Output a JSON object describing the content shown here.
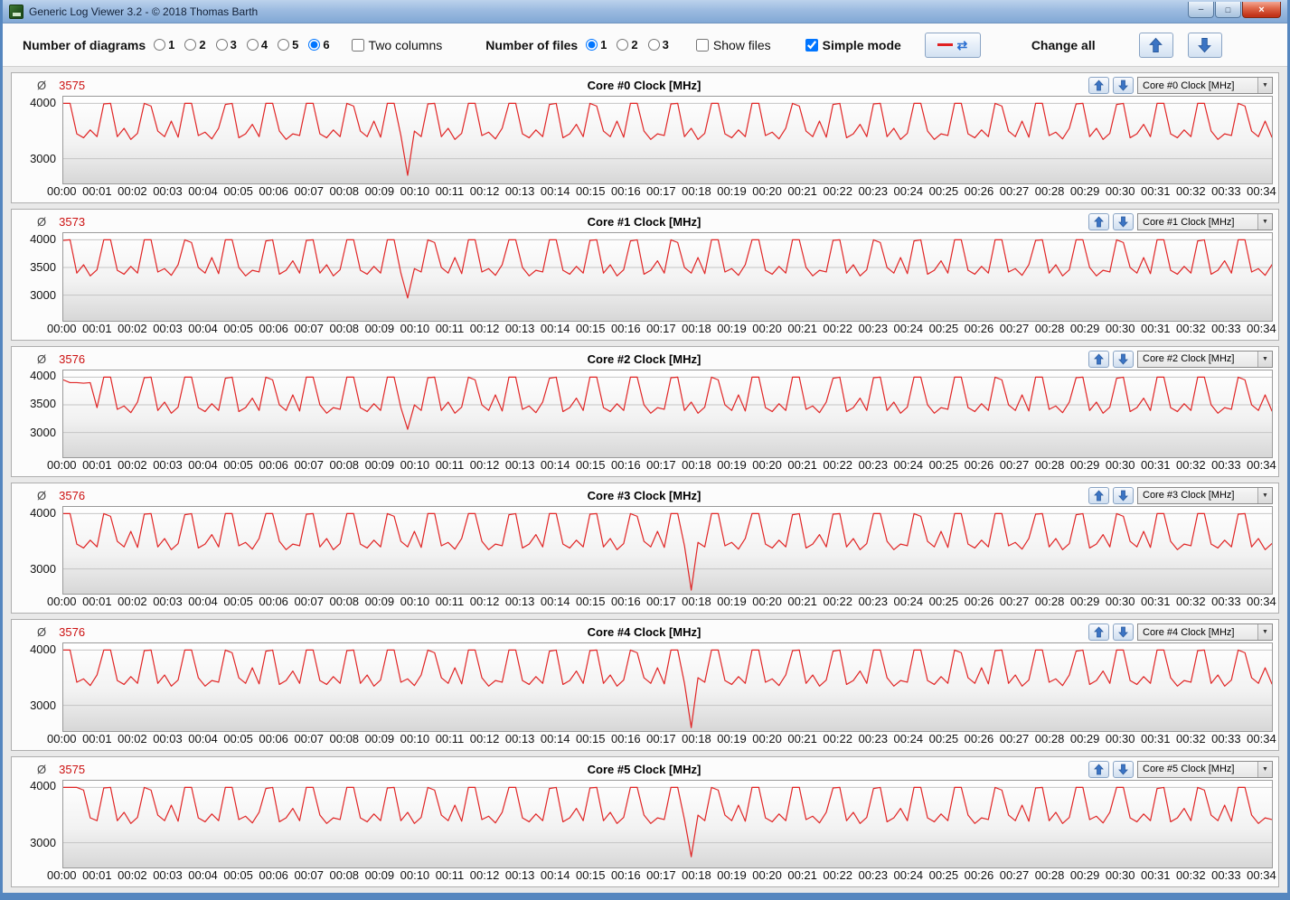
{
  "window": {
    "title": "Generic Log Viewer 3.2 - © 2018 Thomas Barth",
    "minimize_glyph": "–",
    "maximize_glyph": "□",
    "close_glyph": "×"
  },
  "toolbar": {
    "diagrams_label": "Number of diagrams",
    "diagram_options": [
      "1",
      "2",
      "3",
      "4",
      "5",
      "6"
    ],
    "diagrams_selected": "6",
    "two_columns_label": "Two columns",
    "two_columns_checked": false,
    "files_label": "Number of files",
    "file_options": [
      "1",
      "2",
      "3"
    ],
    "files_selected": "1",
    "show_files_label": "Show files",
    "show_files_checked": false,
    "simple_mode_label": "Simple mode",
    "simple_mode_checked": true,
    "refresh_glyph": "⇄",
    "change_all_label": "Change all"
  },
  "colors": {
    "trace": "#e02525",
    "average_text": "#cc1111",
    "grid": "#c4c4c4"
  },
  "avg_symbol": "Ø",
  "x_labels": [
    "00:00",
    "00:01",
    "00:02",
    "00:03",
    "00:04",
    "00:05",
    "00:06",
    "00:07",
    "00:08",
    "00:09",
    "00:10",
    "00:11",
    "00:12",
    "00:13",
    "00:14",
    "00:15",
    "00:16",
    "00:17",
    "00:18",
    "00:19",
    "00:20",
    "00:21",
    "00:22",
    "00:23",
    "00:24",
    "00:25",
    "00:26",
    "00:27",
    "00:28",
    "00:29",
    "00:30",
    "00:31",
    "00:32",
    "00:33",
    "00:34"
  ],
  "chart_data": [
    {
      "type": "line",
      "title": "Core #0 Clock [MHz]",
      "avg": "3575",
      "y_ticks": [
        4000,
        3000
      ],
      "ylim": [
        2550,
        4120
      ],
      "x_range_minutes": [
        0,
        34
      ],
      "values": [
        4000,
        4000,
        3450,
        3380,
        3520,
        3400,
        3990,
        4000,
        3400,
        3550,
        3350,
        3460,
        4000,
        3950,
        3500,
        3400,
        3680,
        3390,
        4000,
        4000,
        3420,
        3480,
        3360,
        3550,
        3980,
        4000,
        3380,
        3450,
        3620,
        3400,
        4000,
        4000,
        3500,
        3350,
        3450,
        3420,
        4000,
        4000,
        3450,
        3380,
        3520,
        3400,
        4000,
        3950,
        3500,
        3400,
        3680,
        3390,
        4000,
        4000,
        3420,
        2700,
        3500,
        3400,
        3990,
        4000,
        3400,
        3550,
        3350,
        3460,
        4000,
        4000,
        3420,
        3480,
        3360,
        3550,
        4000,
        4000,
        3450,
        3380,
        3520,
        3400,
        3980,
        4000,
        3380,
        3450,
        3620,
        3400,
        4000,
        3950,
        3500,
        3400,
        3680,
        3390,
        4000,
        4000,
        3500,
        3350,
        3450,
        3420,
        3990,
        4000,
        3400,
        3550,
        3350,
        3460,
        4000,
        4000,
        3450,
        3380,
        3520,
        3400,
        4000,
        4000,
        3420,
        3480,
        3360,
        3550,
        4000,
        3950,
        3500,
        3400,
        3680,
        3390,
        3980,
        4000,
        3380,
        3450,
        3620,
        3400,
        3990,
        4000,
        3400,
        3550,
        3350,
        3460,
        4000,
        4000,
        3500,
        3350,
        3450,
        3420,
        4000,
        4000,
        3450,
        3380,
        3520,
        3400,
        4000,
        3950,
        3500,
        3400,
        3680,
        3390,
        4000,
        4000,
        3420,
        3480,
        3360,
        3550,
        3990,
        4000,
        3400,
        3550,
        3350,
        3460,
        3980,
        4000,
        3380,
        3450,
        3620,
        3400,
        4000,
        4000,
        3450,
        3380,
        3520,
        3400,
        4000,
        4000,
        3500,
        3350,
        3450,
        3420,
        4000,
        3950,
        3500,
        3400,
        3680,
        3390
      ]
    },
    {
      "type": "line",
      "title": "Core #1 Clock [MHz]",
      "avg": "3573",
      "y_ticks": [
        4000,
        3500,
        3000
      ],
      "ylim": [
        2550,
        4120
      ],
      "x_range_minutes": [
        0,
        34
      ],
      "values": [
        3990,
        4000,
        3400,
        3550,
        3350,
        3460,
        4000,
        4000,
        3450,
        3380,
        3520,
        3400,
        4000,
        4000,
        3420,
        3480,
        3360,
        3550,
        4000,
        3950,
        3500,
        3400,
        3680,
        3390,
        4000,
        4000,
        3500,
        3350,
        3450,
        3420,
        3980,
        4000,
        3380,
        3450,
        3620,
        3400,
        3990,
        4000,
        3400,
        3550,
        3350,
        3460,
        4000,
        4000,
        3450,
        3380,
        3520,
        3400,
        4000,
        4000,
        3400,
        2950,
        3480,
        3420,
        4000,
        3950,
        3500,
        3400,
        3680,
        3390,
        4000,
        4000,
        3420,
        3480,
        3360,
        3550,
        4000,
        4000,
        3500,
        3350,
        3450,
        3420,
        4000,
        4000,
        3450,
        3380,
        3520,
        3400,
        3990,
        4000,
        3400,
        3550,
        3350,
        3460,
        3980,
        4000,
        3380,
        3450,
        3620,
        3400,
        4000,
        3950,
        3500,
        3400,
        3680,
        3390,
        4000,
        4000,
        3420,
        3480,
        3360,
        3550,
        4000,
        4000,
        3450,
        3380,
        3520,
        3400,
        4000,
        4000,
        3500,
        3350,
        3450,
        3420,
        3990,
        4000,
        3400,
        3550,
        3350,
        3460,
        4000,
        3950,
        3500,
        3400,
        3680,
        3390,
        3980,
        4000,
        3380,
        3450,
        3620,
        3400,
        4000,
        4000,
        3450,
        3380,
        3520,
        3400,
        4000,
        4000,
        3420,
        3480,
        3360,
        3550,
        3990,
        4000,
        3400,
        3550,
        3350,
        3460,
        4000,
        4000,
        3500,
        3350,
        3450,
        3420,
        4000,
        3950,
        3500,
        3400,
        3680,
        3390,
        4000,
        4000,
        3450,
        3380,
        3520,
        3400,
        3980,
        4000,
        3380,
        3450,
        3620,
        3400,
        4000,
        4000,
        3420,
        3480,
        3360,
        3550
      ]
    },
    {
      "type": "line",
      "title": "Core #2 Clock [MHz]",
      "avg": "3576",
      "y_ticks": [
        4000,
        3500,
        3000
      ],
      "ylim": [
        2550,
        4120
      ],
      "x_range_minutes": [
        0,
        34
      ],
      "values": [
        3950,
        3900,
        3900,
        3890,
        3900,
        3450,
        4000,
        4000,
        3420,
        3480,
        3360,
        3550,
        3990,
        4000,
        3400,
        3550,
        3350,
        3460,
        4000,
        4000,
        3450,
        3380,
        3520,
        3400,
        3980,
        4000,
        3380,
        3450,
        3620,
        3400,
        4000,
        3950,
        3500,
        3400,
        3680,
        3390,
        4000,
        4000,
        3500,
        3350,
        3450,
        3420,
        4000,
        4000,
        3450,
        3380,
        3520,
        3400,
        4000,
        4000,
        3450,
        3060,
        3500,
        3400,
        3990,
        4000,
        3400,
        3550,
        3350,
        3460,
        4000,
        3950,
        3500,
        3400,
        3680,
        3390,
        4000,
        4000,
        3420,
        3480,
        3360,
        3550,
        3980,
        4000,
        3380,
        3450,
        3620,
        3400,
        4000,
        4000,
        3450,
        3380,
        3520,
        3400,
        4000,
        4000,
        3500,
        3350,
        3450,
        3420,
        3990,
        4000,
        3400,
        3550,
        3350,
        3460,
        4000,
        3950,
        3500,
        3400,
        3680,
        3390,
        4000,
        4000,
        3450,
        3380,
        3520,
        3400,
        4000,
        4000,
        3420,
        3480,
        3360,
        3550,
        3980,
        4000,
        3380,
        3450,
        3620,
        3400,
        3990,
        4000,
        3400,
        3550,
        3350,
        3460,
        4000,
        4000,
        3500,
        3350,
        3450,
        3420,
        4000,
        4000,
        3450,
        3380,
        3520,
        3400,
        4000,
        3950,
        3500,
        3400,
        3680,
        3390,
        4000,
        4000,
        3420,
        3480,
        3360,
        3550,
        3990,
        4000,
        3400,
        3550,
        3350,
        3460,
        3980,
        4000,
        3380,
        3450,
        3620,
        3400,
        4000,
        4000,
        3450,
        3380,
        3520,
        3400,
        4000,
        4000,
        3500,
        3350,
        3450,
        3420,
        4000,
        3950,
        3500,
        3400,
        3680,
        3390
      ]
    },
    {
      "type": "line",
      "title": "Core #3 Clock [MHz]",
      "avg": "3576",
      "y_ticks": [
        4000,
        3000
      ],
      "ylim": [
        2550,
        4120
      ],
      "x_range_minutes": [
        0,
        34
      ],
      "values": [
        4000,
        4000,
        3450,
        3380,
        3520,
        3400,
        4000,
        3950,
        3500,
        3400,
        3680,
        3390,
        3990,
        4000,
        3400,
        3550,
        3350,
        3460,
        3980,
        4000,
        3380,
        3450,
        3620,
        3400,
        4000,
        4000,
        3420,
        3480,
        3360,
        3550,
        4000,
        4000,
        3500,
        3350,
        3450,
        3420,
        3990,
        4000,
        3400,
        3550,
        3350,
        3460,
        4000,
        4000,
        3450,
        3380,
        3520,
        3400,
        4000,
        3950,
        3500,
        3400,
        3680,
        3390,
        4000,
        4000,
        3420,
        3480,
        3360,
        3550,
        4000,
        4000,
        3500,
        3350,
        3450,
        3420,
        3980,
        4000,
        3380,
        3450,
        3620,
        3400,
        4000,
        4000,
        3450,
        3380,
        3520,
        3400,
        3990,
        4000,
        3400,
        3550,
        3350,
        3460,
        4000,
        3950,
        3500,
        3400,
        3680,
        3390,
        4000,
        4000,
        3420,
        2620,
        3480,
        3400,
        4000,
        4000,
        3420,
        3480,
        3360,
        3550,
        4000,
        4000,
        3450,
        3380,
        3520,
        3400,
        3980,
        4000,
        3380,
        3450,
        3620,
        3400,
        3990,
        4000,
        3400,
        3550,
        3350,
        3460,
        4000,
        4000,
        3500,
        3350,
        3450,
        3420,
        4000,
        3950,
        3500,
        3400,
        3680,
        3390,
        4000,
        4000,
        3450,
        3380,
        3520,
        3400,
        4000,
        4000,
        3420,
        3480,
        3360,
        3550,
        3990,
        4000,
        3400,
        3550,
        3350,
        3460,
        3980,
        4000,
        3380,
        3450,
        3620,
        3400,
        4000,
        3950,
        3500,
        3400,
        3680,
        3390,
        4000,
        4000,
        3500,
        3350,
        3450,
        3420,
        4000,
        4000,
        3450,
        3380,
        3520,
        3400,
        3990,
        4000,
        3400,
        3550,
        3350,
        3460
      ]
    },
    {
      "type": "line",
      "title": "Core #4 Clock [MHz]",
      "avg": "3576",
      "y_ticks": [
        4000,
        3000
      ],
      "ylim": [
        2550,
        4120
      ],
      "x_range_minutes": [
        0,
        34
      ],
      "values": [
        4000,
        4000,
        3420,
        3480,
        3360,
        3550,
        4000,
        4000,
        3450,
        3380,
        3520,
        3400,
        3990,
        4000,
        3400,
        3550,
        3350,
        3460,
        4000,
        4000,
        3500,
        3350,
        3450,
        3420,
        4000,
        3950,
        3500,
        3400,
        3680,
        3390,
        3980,
        4000,
        3380,
        3450,
        3620,
        3400,
        4000,
        4000,
        3450,
        3380,
        3520,
        3400,
        3990,
        4000,
        3400,
        3550,
        3350,
        3460,
        4000,
        4000,
        3420,
        3480,
        3360,
        3550,
        4000,
        3950,
        3500,
        3400,
        3680,
        3390,
        4000,
        4000,
        3500,
        3350,
        3450,
        3420,
        4000,
        4000,
        3450,
        3380,
        3520,
        3400,
        3980,
        4000,
        3380,
        3450,
        3620,
        3400,
        3990,
        4000,
        3400,
        3550,
        3350,
        3460,
        4000,
        3950,
        3500,
        3400,
        3680,
        3390,
        4000,
        4000,
        3400,
        2600,
        3500,
        3420,
        4000,
        4000,
        3450,
        3380,
        3520,
        3400,
        4000,
        4000,
        3420,
        3480,
        3360,
        3550,
        3990,
        4000,
        3400,
        3550,
        3350,
        3460,
        3980,
        4000,
        3380,
        3450,
        3620,
        3400,
        4000,
        4000,
        3500,
        3350,
        3450,
        3420,
        4000,
        4000,
        3450,
        3380,
        3520,
        3400,
        4000,
        3950,
        3500,
        3400,
        3680,
        3390,
        3990,
        4000,
        3400,
        3550,
        3350,
        3460,
        4000,
        4000,
        3420,
        3480,
        3360,
        3550,
        3980,
        4000,
        3380,
        3450,
        3620,
        3400,
        4000,
        4000,
        3450,
        3380,
        3520,
        3400,
        4000,
        4000,
        3500,
        3350,
        3450,
        3420,
        3990,
        4000,
        3400,
        3550,
        3350,
        3460,
        4000,
        3950,
        3500,
        3400,
        3680,
        3390
      ]
    },
    {
      "type": "line",
      "title": "Core #5 Clock [MHz]",
      "avg": "3575",
      "y_ticks": [
        4000,
        3000
      ],
      "ylim": [
        2550,
        4120
      ],
      "x_range_minutes": [
        0,
        34
      ],
      "values": [
        4000,
        4000,
        4000,
        3950,
        3450,
        3400,
        3990,
        4000,
        3400,
        3550,
        3350,
        3460,
        4000,
        3950,
        3500,
        3400,
        3680,
        3390,
        4000,
        4000,
        3450,
        3380,
        3520,
        3400,
        4000,
        4000,
        3420,
        3480,
        3360,
        3550,
        3980,
        4000,
        3380,
        3450,
        3620,
        3400,
        4000,
        4000,
        3500,
        3350,
        3450,
        3420,
        4000,
        4000,
        3450,
        3380,
        3520,
        3400,
        3990,
        4000,
        3400,
        3550,
        3350,
        3460,
        4000,
        3950,
        3500,
        3400,
        3680,
        3390,
        4000,
        4000,
        3420,
        3480,
        3360,
        3550,
        4000,
        4000,
        3450,
        3380,
        3520,
        3400,
        3980,
        4000,
        3380,
        3450,
        3620,
        3400,
        3990,
        4000,
        3400,
        3550,
        3350,
        3460,
        4000,
        4000,
        3500,
        3350,
        3450,
        3420,
        4000,
        4000,
        3420,
        2750,
        3500,
        3400,
        4000,
        3950,
        3500,
        3400,
        3680,
        3390,
        4000,
        4000,
        3450,
        3380,
        3520,
        3400,
        4000,
        4000,
        3420,
        3480,
        3360,
        3550,
        3990,
        4000,
        3400,
        3550,
        3350,
        3460,
        3980,
        4000,
        3380,
        3450,
        3620,
        3400,
        4000,
        4000,
        3450,
        3380,
        3520,
        3400,
        4000,
        4000,
        3500,
        3350,
        3450,
        3420,
        4000,
        3950,
        3500,
        3400,
        3680,
        3390,
        3990,
        4000,
        3400,
        3550,
        3350,
        3460,
        4000,
        4000,
        3420,
        3480,
        3360,
        3550,
        4000,
        4000,
        3450,
        3380,
        3520,
        3400,
        3980,
        4000,
        3380,
        3450,
        3620,
        3400,
        4000,
        3950,
        3500,
        3400,
        3680,
        3390,
        4000,
        4000,
        3500,
        3350,
        3450,
        3420
      ]
    }
  ]
}
